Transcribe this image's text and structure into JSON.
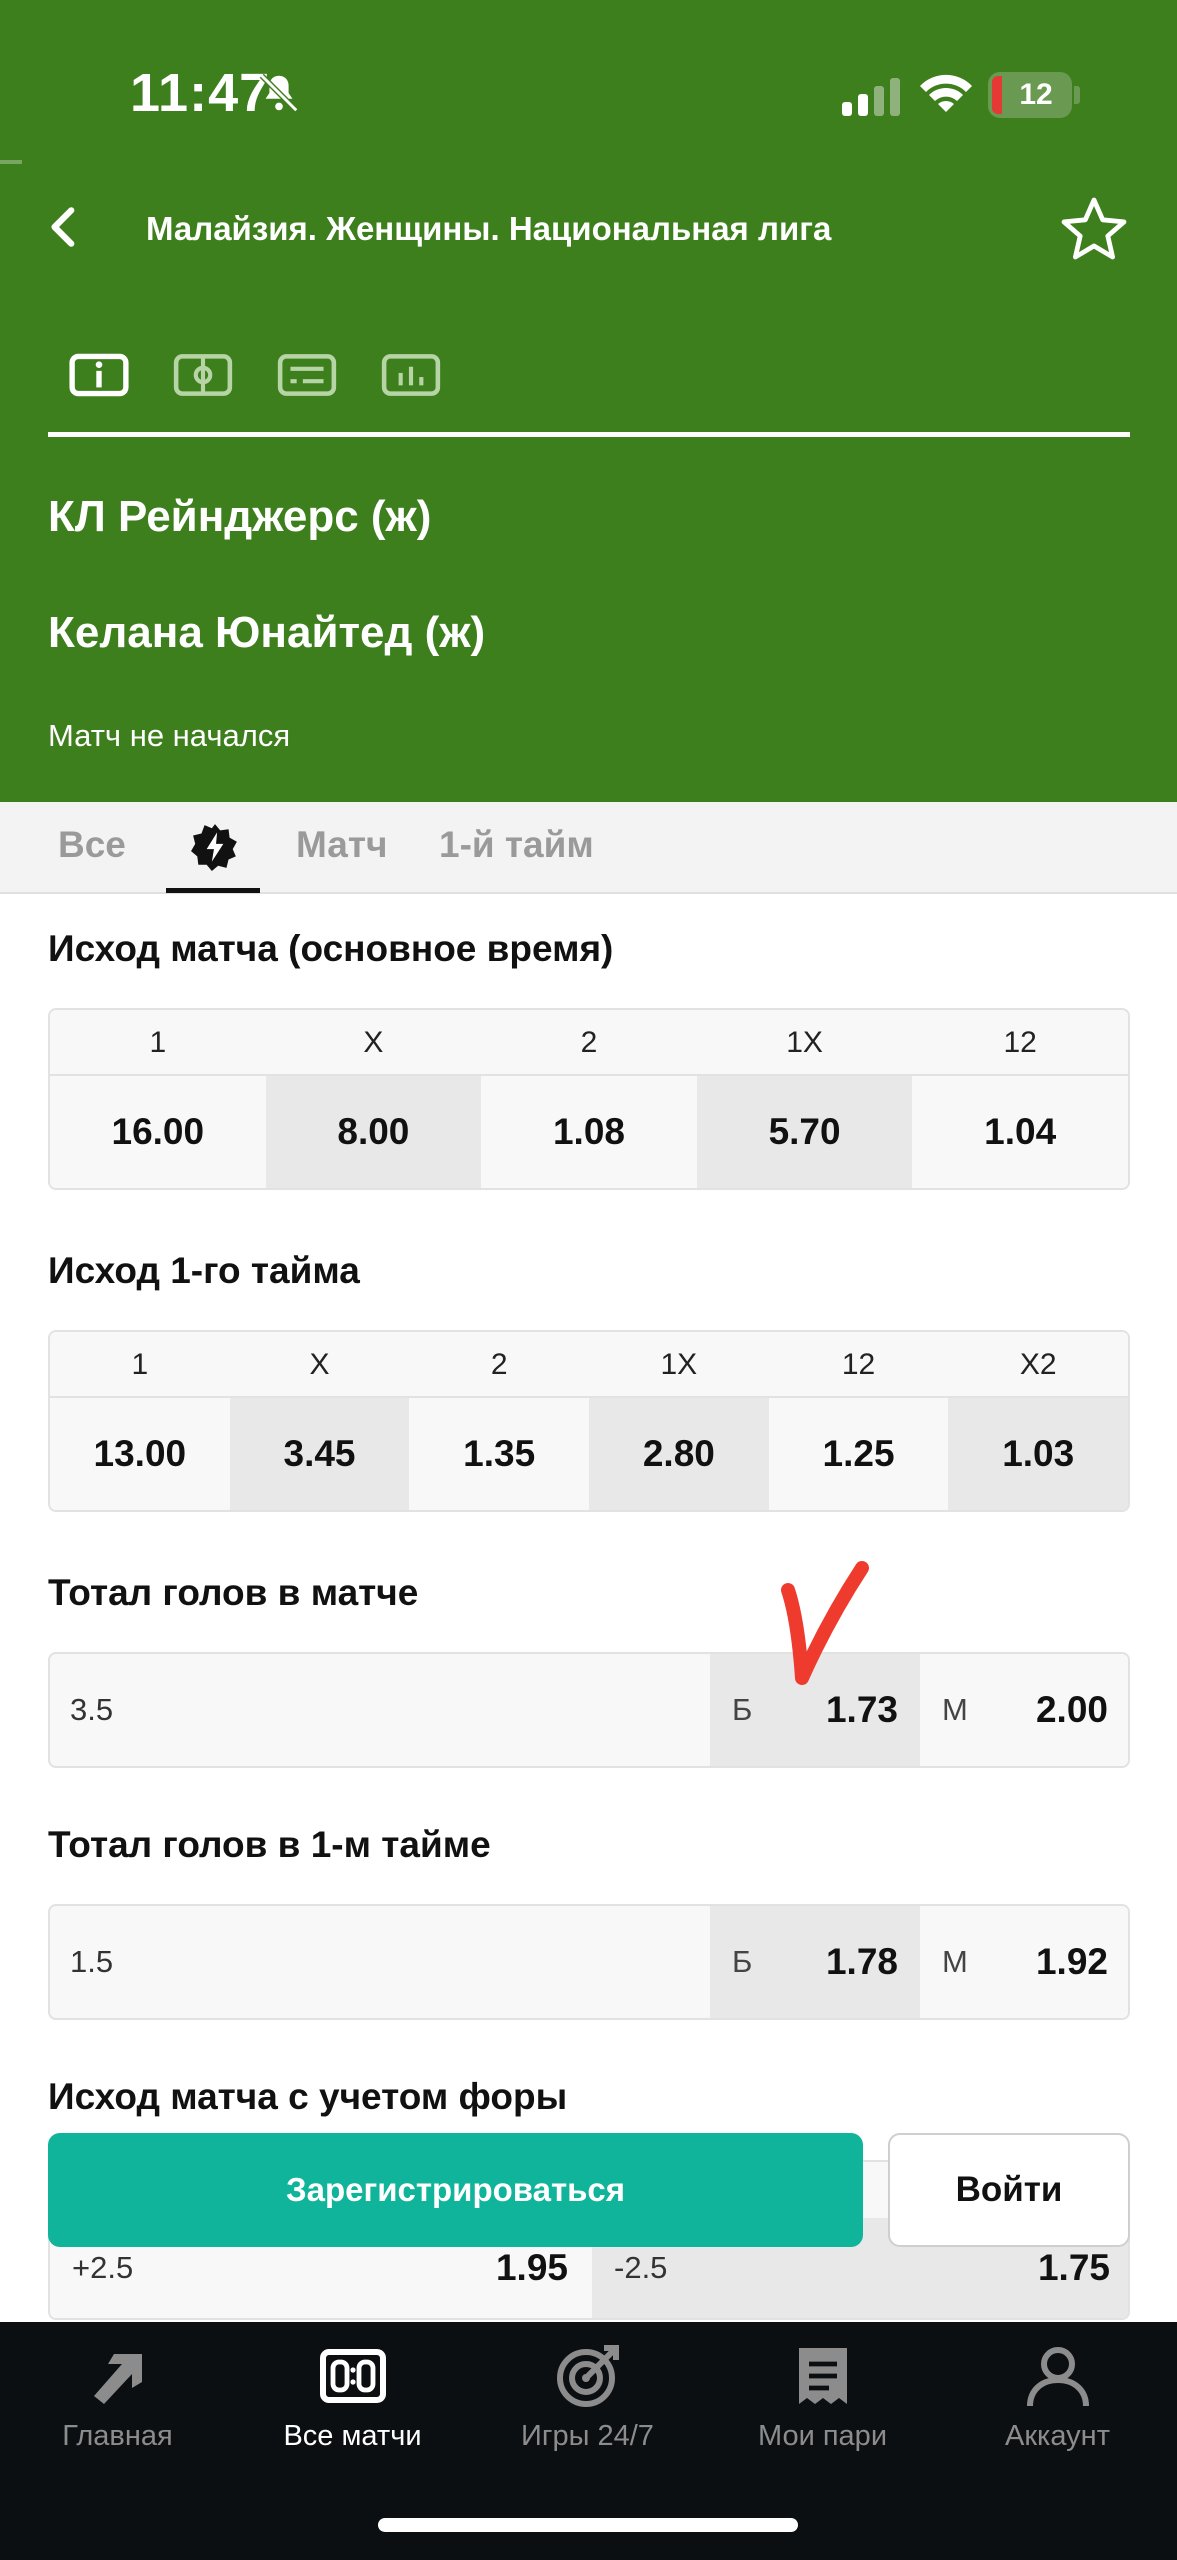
{
  "status_bar": {
    "time": "11:47",
    "battery": "12",
    "icons": [
      "bell-muted-icon",
      "signal-icon",
      "wifi-icon",
      "battery-icon"
    ]
  },
  "header": {
    "league_title": "Малайзия. Женщины. Национальная лига",
    "team_home": "КЛ Рейнджерс (ж)",
    "team_away": "Келана Юнайтед (ж)",
    "match_status": "Матч не начался",
    "icon_tabs": [
      "info-icon",
      "field-icon",
      "lineup-icon",
      "stats-icon"
    ],
    "active_icon_tab": 0,
    "colors": {
      "header_bg": "#3e7f1d"
    }
  },
  "filter_tabs": {
    "items": [
      "Все",
      "Матч",
      "1-й тайм"
    ],
    "active": "lightning-icon"
  },
  "markets": {
    "full_time": {
      "title": "Исход матча (основное время)",
      "headers": [
        "1",
        "X",
        "2",
        "1X",
        "12"
      ],
      "odds": [
        "16.00",
        "8.00",
        "1.08",
        "5.70",
        "1.04"
      ]
    },
    "first_half": {
      "title": "Исход 1-го тайма",
      "headers": [
        "1",
        "X",
        "2",
        "1X",
        "12",
        "X2"
      ],
      "odds": [
        "13.00",
        "3.45",
        "1.35",
        "2.80",
        "1.25",
        "1.03"
      ]
    },
    "total_match": {
      "title": "Тотал голов в матче",
      "line": "3.5",
      "over_label": "Б",
      "over_odd": "1.73",
      "under_label": "М",
      "under_odd": "2.00"
    },
    "total_first_half": {
      "title": "Тотал голов в 1-м тайме",
      "line": "1.5",
      "over_label": "Б",
      "over_odd": "1.78",
      "under_label": "М",
      "under_odd": "1.92"
    },
    "handicap": {
      "title": "Исход матча с учетом форы",
      "home_line": "+2.5",
      "home_odd": "1.95",
      "away_line": "-2.5",
      "away_odd": "1.75"
    }
  },
  "cta": {
    "register": "Зарегистрироваться",
    "login": "Войти",
    "colors": {
      "register_bg": "#10b49a"
    }
  },
  "bottom_nav": {
    "items": [
      {
        "label": "Главная",
        "icon": "home-arrow-icon"
      },
      {
        "label": "Все матчи",
        "icon": "scoreboard-icon"
      },
      {
        "label": "Игры 24/7",
        "icon": "target-icon"
      },
      {
        "label": "Мои пари",
        "icon": "ticket-icon"
      },
      {
        "label": "Аккаунт",
        "icon": "user-icon"
      }
    ],
    "active_index": 1
  }
}
